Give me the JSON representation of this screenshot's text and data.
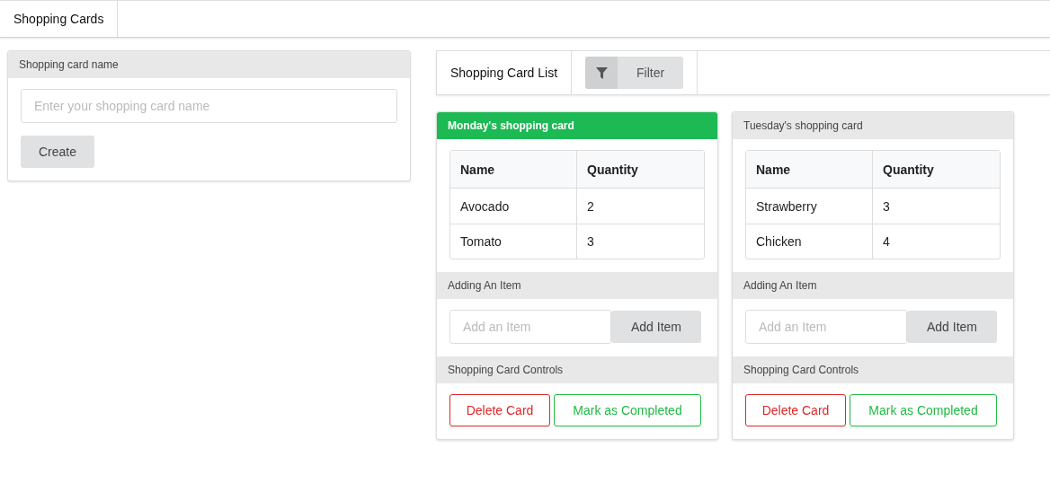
{
  "nav": {
    "tab": "Shopping Cards"
  },
  "create_panel": {
    "title": "Shopping card name",
    "placeholder": "Enter your shopping card name",
    "button": "Create"
  },
  "list_header": {
    "title": "Shopping Card List",
    "filter_button": "Filter"
  },
  "cards": [
    {
      "title": "Monday's shopping card",
      "selected": true,
      "columns": [
        "Name",
        "Quantity"
      ],
      "rows": [
        [
          "Avocado",
          "2"
        ],
        [
          "Tomato",
          "3"
        ]
      ],
      "add_section": "Adding An Item",
      "add_placeholder": "Add an Item",
      "add_button": "Add Item",
      "controls_section": "Shopping Card Controls",
      "delete_button": "Delete Card",
      "complete_button": "Mark as Completed"
    },
    {
      "title": "Tuesday's shopping card",
      "selected": false,
      "columns": [
        "Name",
        "Quantity"
      ],
      "rows": [
        [
          "Strawberry",
          "3"
        ],
        [
          "Chicken",
          "4"
        ]
      ],
      "add_section": "Adding An Item",
      "add_placeholder": "Add an Item",
      "add_button": "Add Item",
      "controls_section": "Shopping Card Controls",
      "delete_button": "Delete Card",
      "complete_button": "Mark as Completed"
    }
  ]
}
